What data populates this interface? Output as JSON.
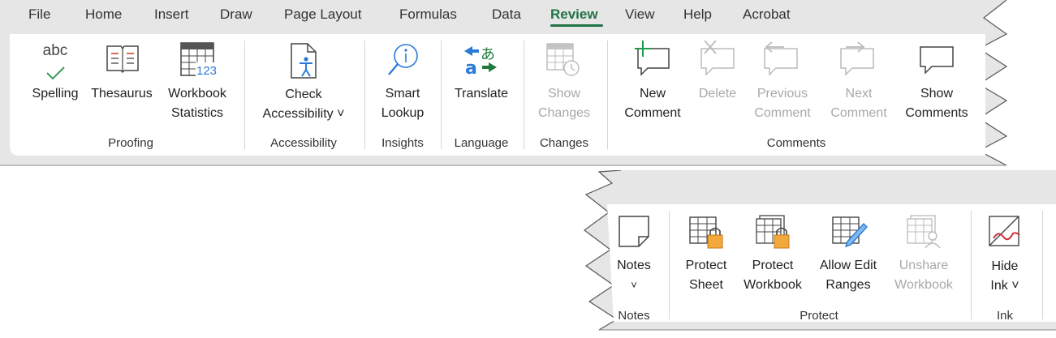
{
  "tabs": [
    "File",
    "Home",
    "Insert",
    "Draw",
    "Page Layout",
    "Formulas",
    "Data",
    "Review",
    "View",
    "Help",
    "Acrobat"
  ],
  "active_tab": "Review",
  "colors": {
    "accent": "#217346",
    "disabled": "#a8a8a8",
    "ribbon_bg": "#e6e6e6",
    "panel_bg": "#ffffff"
  },
  "top_ribbon": {
    "spelling": "Spelling",
    "thesaurus": "Thesaurus",
    "workbook_statistics": [
      "Workbook",
      "Statistics"
    ],
    "check_accessibility": [
      "Check",
      "Accessibility ˅"
    ],
    "smart_lookup": [
      "Smart",
      "Lookup"
    ],
    "translate": "Translate",
    "show_changes": [
      "Show",
      "Changes"
    ],
    "new_comment": [
      "New",
      "Comment"
    ],
    "delete": "Delete",
    "previous_comment": [
      "Previous",
      "Comment"
    ],
    "next_comment": [
      "Next",
      "Comment"
    ],
    "show_comments": [
      "Show",
      "Comments"
    ],
    "abc_glyph": "abc",
    "groups": {
      "proofing": "Proofing",
      "accessibility": "Accessibility",
      "insights": "Insights",
      "language": "Language",
      "changes": "Changes",
      "comments": "Comments"
    }
  },
  "bottom_ribbon": {
    "notes": [
      "Notes",
      "˅"
    ],
    "protect_sheet": [
      "Protect",
      "Sheet"
    ],
    "protect_workbook": [
      "Protect",
      "Workbook"
    ],
    "allow_edit_ranges": [
      "Allow Edit",
      "Ranges"
    ],
    "unshare_workbook": [
      "Unshare",
      "Workbook"
    ],
    "hide_ink": [
      "Hide",
      "Ink ˅"
    ],
    "groups": {
      "notes": "Notes",
      "protect": "Protect",
      "ink": "Ink"
    }
  }
}
